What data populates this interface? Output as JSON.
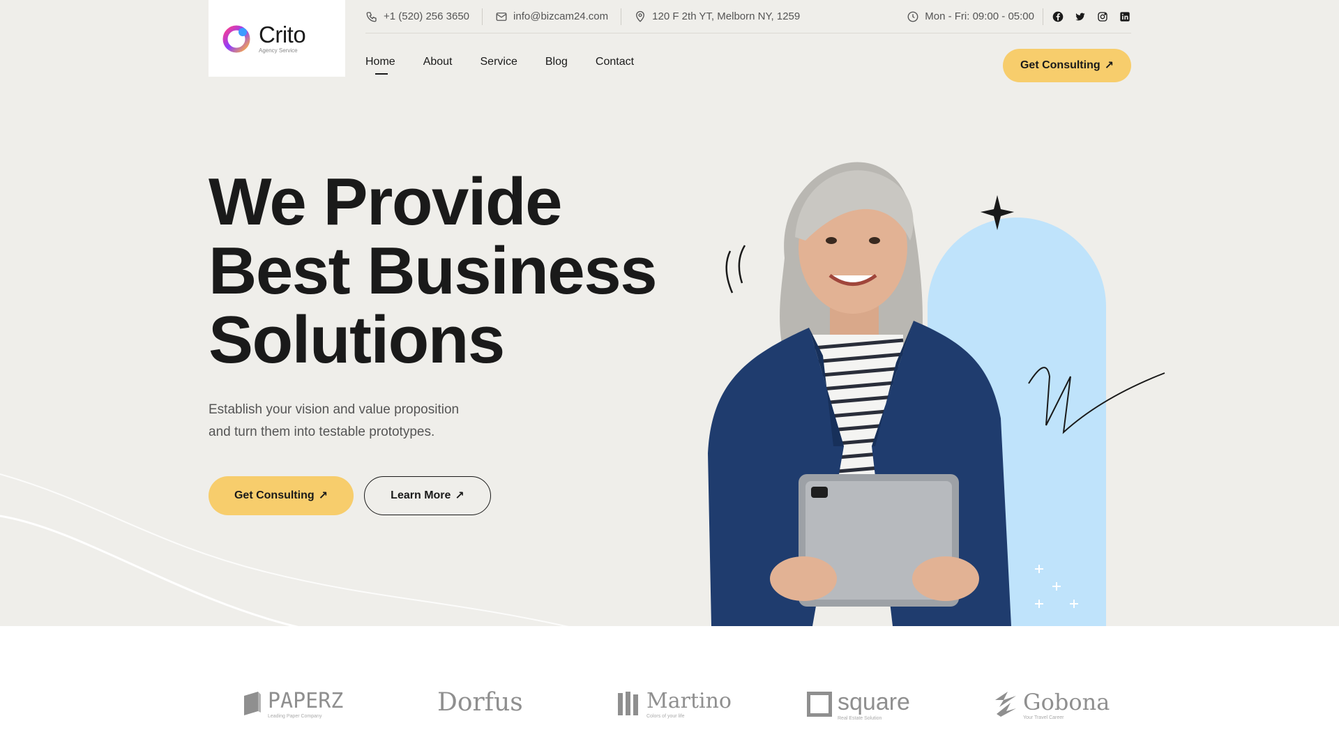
{
  "brand": {
    "name": "Crito",
    "tagline": "Agency Service"
  },
  "topbar": {
    "phone": "+1 (520) 256 3650",
    "email": "info@bizcam24.com",
    "address": "120 F 2th YT, Melborn NY, 1259",
    "hours": "Mon - Fri: 09:00 - 05:00",
    "social": [
      "facebook-icon",
      "twitter-icon",
      "instagram-icon",
      "linkedin-icon"
    ]
  },
  "nav": {
    "items": [
      {
        "label": "Home",
        "active": true
      },
      {
        "label": "About"
      },
      {
        "label": "Service"
      },
      {
        "label": "Blog"
      },
      {
        "label": "Contact"
      }
    ],
    "cta": "Get Consulting"
  },
  "hero": {
    "title_lines": [
      "We Provide",
      "Best Business",
      "Solutions"
    ],
    "subtitle_line1": "Establish your vision and value proposition",
    "subtitle_line2": "and turn them into testable prototypes.",
    "primary_button": "Get Consulting",
    "secondary_button": "Learn More"
  },
  "partners": [
    {
      "name": "PAPERZ",
      "sub": "Leading Paper Company"
    },
    {
      "name": "Dorfus",
      "sub": ""
    },
    {
      "name": "Martino",
      "sub": "Colors of your life"
    },
    {
      "name": "square",
      "sub": "Real Estate Solution"
    },
    {
      "name": "Gobona",
      "sub": "Your Travel Career"
    }
  ],
  "colors": {
    "hero_bg": "#efeeea",
    "accent": "#f7cd6c",
    "blob": "#bfe3fb",
    "jacket": "#1f3c6e"
  }
}
